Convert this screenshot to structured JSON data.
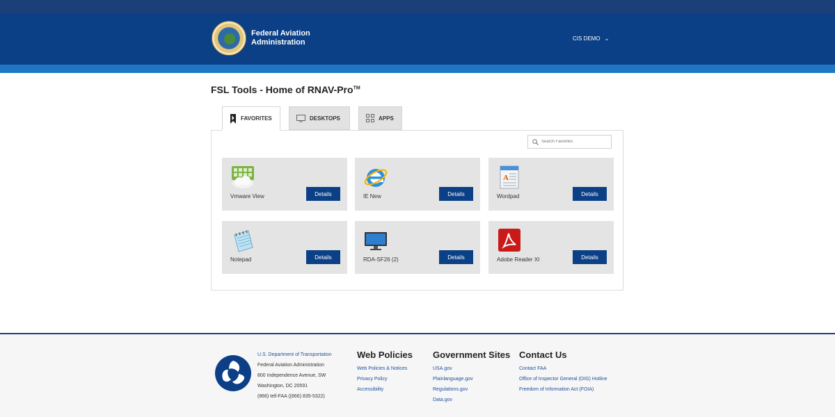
{
  "header": {
    "agency_line1": "Federal Aviation",
    "agency_line2": "Administration",
    "user_menu": "CIS DEMO"
  },
  "page": {
    "title": "FSL Tools - Home of RNAV-Pro",
    "title_mark": "TM"
  },
  "tabs": [
    {
      "label": "FAVORITES",
      "icon": "bookmark-icon",
      "active": true
    },
    {
      "label": "DESKTOPS",
      "icon": "monitor-icon",
      "active": false
    },
    {
      "label": "APPS",
      "icon": "grid-icon",
      "active": false
    }
  ],
  "search": {
    "placeholder": "Search Favorites"
  },
  "apps": [
    {
      "name": "Vmware View",
      "icon": "vmware-view-icon",
      "button": "Details"
    },
    {
      "name": "IE New",
      "icon": "internet-explorer-icon",
      "button": "Details"
    },
    {
      "name": "Wordpad",
      "icon": "wordpad-icon",
      "button": "Details"
    },
    {
      "name": "Notepad",
      "icon": "notepad-icon",
      "button": "Details"
    },
    {
      "name": "RDA-SF26 (2)",
      "icon": "desktop-monitor-icon",
      "button": "Details"
    },
    {
      "name": "Adobe Reader XI",
      "icon": "adobe-reader-icon",
      "button": "Details"
    }
  ],
  "footer": {
    "address": {
      "department": "U.S. Department of Transportation",
      "agency": "Federal Aviation Administration",
      "street": "800 Independence Avenue, SW",
      "city": "Washington, DC 20591",
      "phone": "(866) tell-FAA ((866) 835-5322)"
    },
    "web_policies": {
      "heading": "Web Policies",
      "links": [
        "Web Policies & Notices",
        "Privacy Policy",
        "Accessibility"
      ]
    },
    "government_sites": {
      "heading": "Government Sites",
      "links": [
        "USA.gov",
        "Plainlanguage.gov",
        "Regulations.gov",
        "Data.gov"
      ]
    },
    "contact": {
      "heading": "Contact Us",
      "links": [
        "Contact FAA",
        "Office of Inspector General (OIG) Hotline",
        "Freedom of Information Act (FOIA)"
      ]
    }
  },
  "colors": {
    "header_bg": "#0b3f86",
    "header_stripe": "#1f77c4",
    "button_bg": "#0b3f86",
    "card_bg": "#e4e4e4",
    "link": "#1f4f9c"
  }
}
